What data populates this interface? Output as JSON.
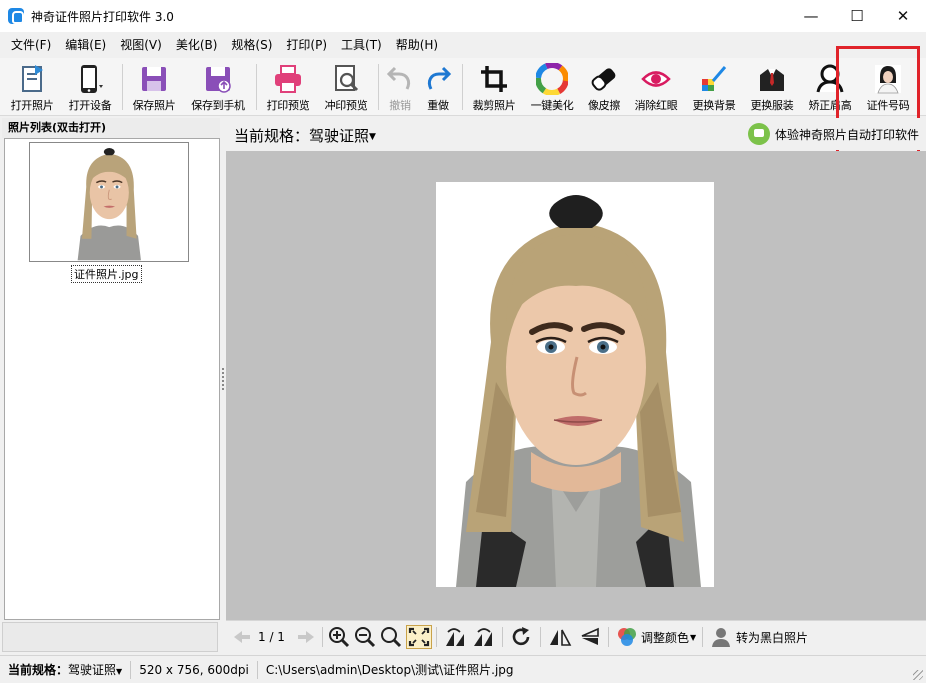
{
  "window": {
    "title": "神奇证件照片打印软件 3.0",
    "controls": [
      "—",
      "☐",
      "✕"
    ]
  },
  "menu": [
    "文件(F)",
    "编辑(E)",
    "视图(V)",
    "美化(B)",
    "规格(S)",
    "打印(P)",
    "工具(T)",
    "帮助(H)"
  ],
  "toolbar": {
    "open_photo": "打开照片",
    "open_device": "打开设备",
    "save_photo": "保存照片",
    "save_to_phone": "保存到手机",
    "print_preview": "打印预览",
    "develop_preview": "冲印预览",
    "undo": "撤销",
    "redo": "重做",
    "crop": "裁剪照片",
    "beautify": "一键美化",
    "eraser": "像皮擦",
    "red_eye": "消除红眼",
    "background": "更换背景",
    "clothing": "更换服装",
    "shoulder": "矫正肩高",
    "id_number": "证件号码"
  },
  "photo_list": {
    "header": "照片列表(双击打开)",
    "items": [
      {
        "filename": "证件照片.jpg"
      }
    ]
  },
  "main": {
    "current_spec_label": "当前规格：",
    "current_spec": "驾驶证照",
    "promo": "体验神奇照片自动打印软件"
  },
  "nav": {
    "page": "1 / 1",
    "adjust_color": "调整颜色",
    "to_bw": "转为黑白照片"
  },
  "status": {
    "spec_label": "当前规格：",
    "spec_value": "驾驶证照",
    "size": "520 x 756, 600dpi",
    "path": "C:\\Users\\admin\\Desktop\\测试\\证件照片.jpg"
  },
  "colors": {
    "highlight": "#e0232a",
    "accent_pink": "#e0407a",
    "accent_purple": "#8a4fb8",
    "accent_blue": "#1e78d2"
  }
}
